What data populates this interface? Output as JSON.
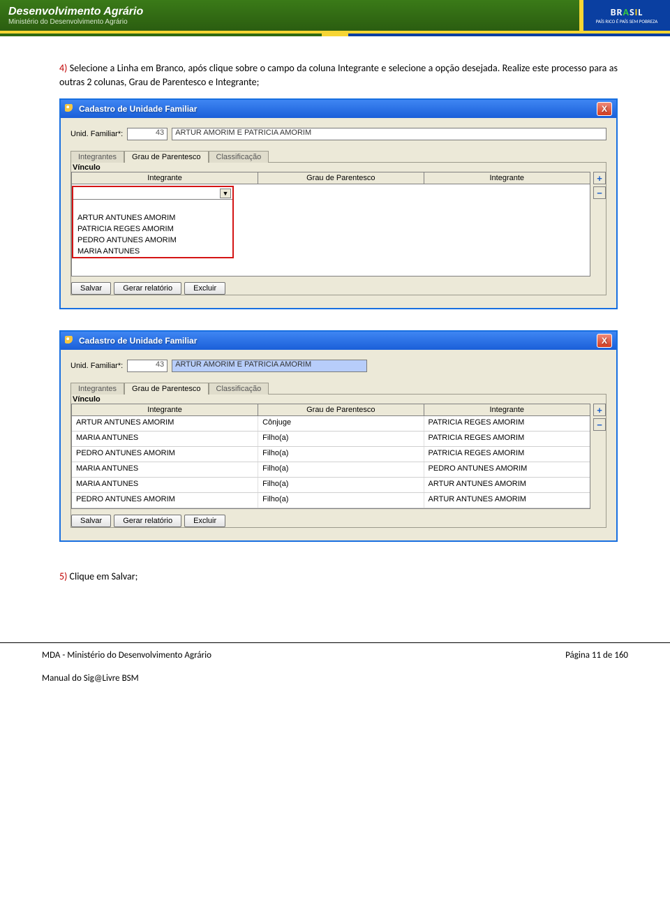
{
  "banner": {
    "title": "Desenvolvimento Agrário",
    "subtitle": "Ministério do Desenvolvimento Agrário",
    "brand_logo_text": "BRASIL",
    "brand_slogan": "PAÍS RICO É PAÍS SEM POBREZA"
  },
  "steps": {
    "s4_num": "4)",
    "s4_text": "Selecione a Linha em Branco, após clique sobre o campo da coluna Integrante e selecione a opção desejada. Realize este processo para as outras 2 colunas, Grau de Parentesco e Integrante;",
    "s5_num": "5)",
    "s5_text": "Clique em Salvar;"
  },
  "window": {
    "title": "Cadastro de Unidade Familiar",
    "close_label": "X",
    "unid_label": "Unid. Familiar*:",
    "unid_id": "43",
    "unid_name": "ARTUR  AMORIM E PATRICIA AMORIM",
    "tabs": {
      "t1": "Integrantes",
      "t2": "Grau de Parentesco",
      "t3": "Classificação"
    },
    "vinculo_label": "Vínculo",
    "cols": {
      "c1": "Integrante",
      "c2": "Grau de Parentesco",
      "c3": "Integrante"
    },
    "buttons": {
      "salvar": "Salvar",
      "gerar": "Gerar relatório",
      "excluir": "Excluir"
    },
    "side": {
      "plus": "+",
      "minus": "−"
    }
  },
  "dropdown": {
    "opt1": "ARTUR ANTUNES AMORIM",
    "opt2": "PATRICIA REGES AMORIM",
    "opt3": "PEDRO ANTUNES AMORIM",
    "opt4": "MARIA ANTUNES"
  },
  "grid2": {
    "rows": [
      {
        "a": "ARTUR ANTUNES AMORIM",
        "b": "Cônjuge",
        "c": "PATRICIA REGES AMORIM"
      },
      {
        "a": "MARIA ANTUNES",
        "b": "Filho(a)",
        "c": "PATRICIA REGES AMORIM"
      },
      {
        "a": "PEDRO ANTUNES AMORIM",
        "b": "Filho(a)",
        "c": "PATRICIA REGES AMORIM"
      },
      {
        "a": "MARIA ANTUNES",
        "b": "Filho(a)",
        "c": "PEDRO ANTUNES AMORIM"
      },
      {
        "a": "MARIA ANTUNES",
        "b": "Filho(a)",
        "c": "ARTUR ANTUNES AMORIM"
      },
      {
        "a": "PEDRO ANTUNES AMORIM",
        "b": "Filho(a)",
        "c": "ARTUR ANTUNES AMORIM"
      }
    ]
  },
  "footer": {
    "left": "MDA - Ministério do Desenvolvimento Agrário",
    "right": "Página 11 de 160",
    "line2": "Manual do Sig@Livre BSM"
  }
}
